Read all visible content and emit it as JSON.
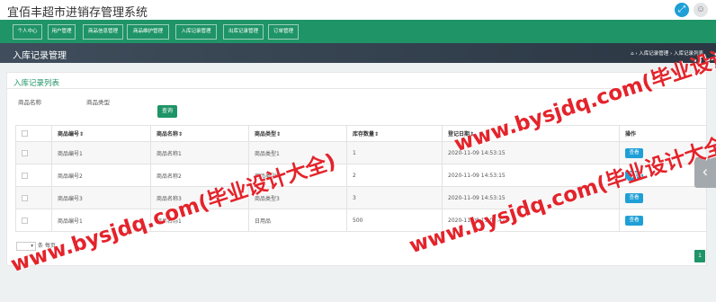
{
  "app": {
    "title": "宜佰丰超市进销存管理系统"
  },
  "icons": {
    "fullscreen": "expand-icon",
    "user": "user-icon",
    "home": "home-icon",
    "side_arrow": "chevron-left-icon"
  },
  "nav": {
    "items": [
      {
        "label": "个人中心"
      },
      {
        "label": "用户管理"
      },
      {
        "label": "商品信息管理"
      },
      {
        "label": "商品维护管理"
      },
      {
        "label": "入库记录管理"
      },
      {
        "label": "出库记录管理"
      },
      {
        "label": "订单管理"
      }
    ]
  },
  "page_header": {
    "title": "入库记录管理",
    "breadcrumb_1": "› 入库记录管理",
    "breadcrumb_2": "› 入库记录列表"
  },
  "panel": {
    "title": "入库记录列表"
  },
  "filters": {
    "name_label": "商品名称",
    "type_label": "商品类型",
    "search_button": "查询"
  },
  "table": {
    "headers": [
      "",
      "商品编号",
      "商品名称",
      "商品类型",
      "库存数量",
      "登记日期",
      "操作"
    ],
    "rows": [
      {
        "code": "商品编号1",
        "name": "商品名称1",
        "type": "商品类型1",
        "qty": "1",
        "date": "2020-11-09 14:53:15",
        "action": "查看"
      },
      {
        "code": "商品编号2",
        "name": "商品名称2",
        "type": "商品类型2",
        "qty": "2",
        "date": "2020-11-09 14:53:15",
        "action": "查看"
      },
      {
        "code": "商品编号3",
        "name": "商品名称3",
        "type": "商品类型3",
        "qty": "3",
        "date": "2020-11-09 14:53:15",
        "action": "查看"
      },
      {
        "code": "商品编号1",
        "name": "商品名称1",
        "type": "日用品",
        "qty": "500",
        "date": "2020-11-08 15:04:47",
        "action": "查看"
      }
    ]
  },
  "pagination": {
    "per_page_suffix": "条 每页",
    "current_page": "1"
  },
  "watermark": {
    "text": "www.bysjdq.com(毕业设计大全)"
  },
  "colors": {
    "primary": "#1f9467",
    "info": "#1e9fd6",
    "header_dark": "#3f4d5c",
    "watermark": "#e4232b"
  }
}
